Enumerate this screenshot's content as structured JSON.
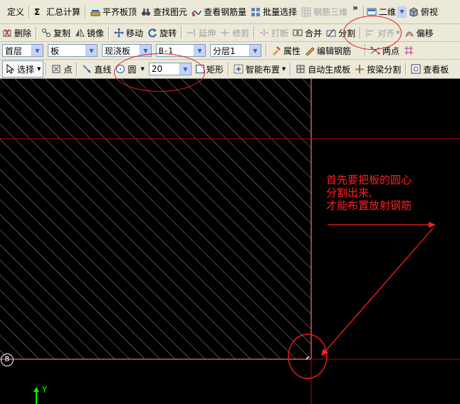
{
  "toolbar1": {
    "define": "定义",
    "summary_calc": "汇总计算",
    "align_slab_top": "平齐板顶",
    "find_element": "查找图元",
    "view_rebar_qty": "查看钢筋量",
    "batch_select": "批量选择",
    "rebar_3d": "钢筋三维",
    "more": "»",
    "view_mode": "二维",
    "top_view": "俯视"
  },
  "toolbar2": {
    "delete": "删除",
    "copy": "复制",
    "mirror": "镜像",
    "move": "移动",
    "rotate": "旋转",
    "extend": "延伸",
    "trim": "修剪",
    "break": "打断",
    "merge": "合并",
    "split": "分割",
    "align": "对齐",
    "offset": "偏移"
  },
  "toolbar3": {
    "floor": "首层",
    "component_type": "板",
    "subtype": "现浇板",
    "component_name": "B-1",
    "layer": "分层1",
    "properties": "属性",
    "edit_rebar": "编辑钢筋",
    "two_points": "两点"
  },
  "toolbar4": {
    "select": "选择",
    "point": "点",
    "line": "直线",
    "circle": "圆",
    "circle_value": "20",
    "rectangle": "矩形",
    "smart_layout": "智能布置",
    "auto_generate_slab": "自动生成板",
    "split_by_beam": "按梁分割",
    "view_slab": "查看板"
  },
  "canvas": {
    "annotation_lines": [
      "首先要把板的圆心",
      "分割出来,",
      "才能布置放射钢筋"
    ],
    "axis_y_label": "Y",
    "grid_marker": "B"
  },
  "colors": {
    "annotation": "#ff2020",
    "grid_line": "#c00000",
    "slab_edge": "#ffffff",
    "axis": "#00ff00"
  }
}
